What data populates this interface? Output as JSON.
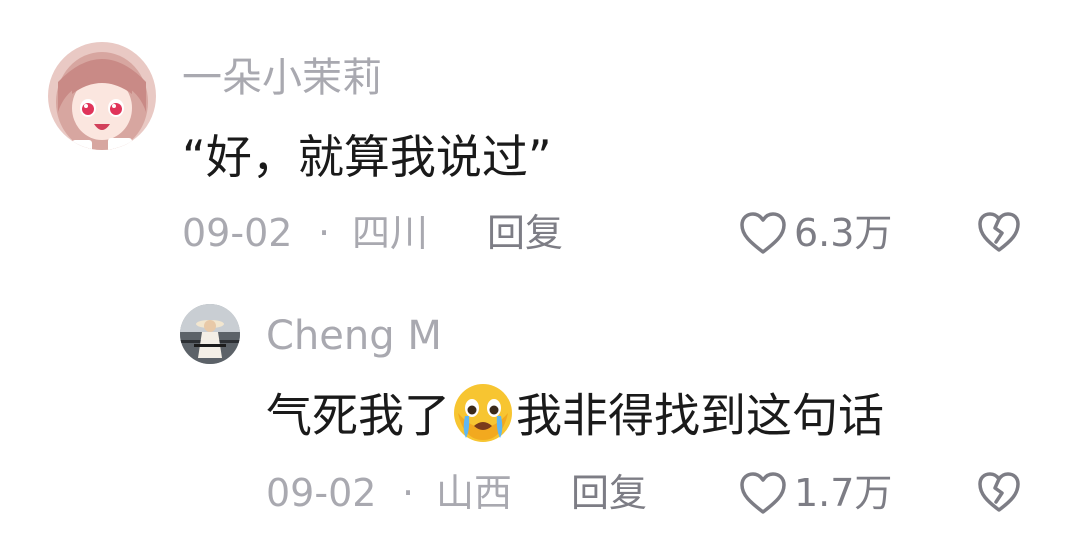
{
  "comments": [
    {
      "username": "一朵小茉莉",
      "text": "“好，就算我说过”",
      "date": "09-02",
      "separator": "·",
      "location": "四川",
      "reply_label": "回复",
      "like_count": "6.3万",
      "avatar_icon": "anime-girl-avatar",
      "like_icon": "heart-outline-icon",
      "dislike_icon": "broken-heart-icon"
    },
    {
      "username": "Cheng M",
      "text_before": "气死我了",
      "emoji": "crying-face-emoji",
      "text_after": "我非得找到这句话",
      "date": "09-02",
      "separator": "·",
      "location": "山西",
      "reply_label": "回复",
      "like_count": "1.7万",
      "avatar_icon": "person-with-hat-photo-avatar",
      "like_icon": "heart-outline-icon",
      "dislike_icon": "broken-heart-icon"
    }
  ],
  "colors": {
    "username": "#a9a9b0",
    "text": "#1a1a1a",
    "meta": "#a9a9b0",
    "action": "#7d7d85"
  }
}
